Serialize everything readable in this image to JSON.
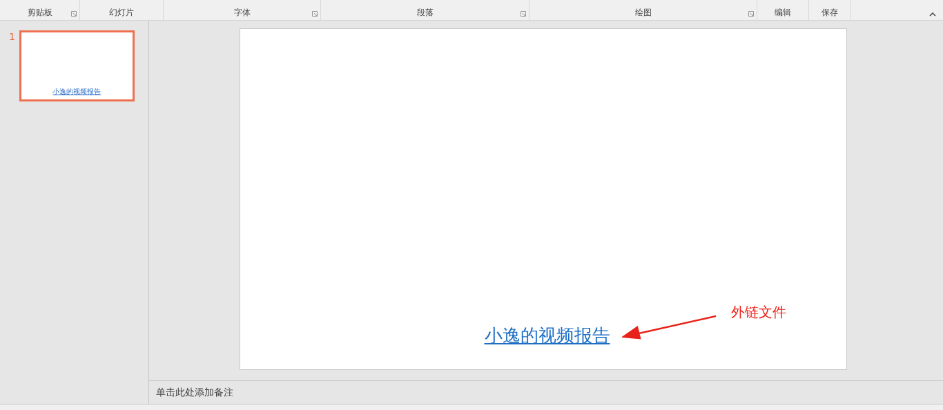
{
  "ribbon": {
    "groups": [
      {
        "label": "剪贴板",
        "launcher": true
      },
      {
        "label": "幻灯片",
        "launcher": false
      },
      {
        "label": "字体",
        "launcher": true
      },
      {
        "label": "段落",
        "launcher": true
      },
      {
        "label": "绘图",
        "launcher": true
      },
      {
        "label": "编辑",
        "launcher": false
      },
      {
        "label": "保存",
        "launcher": false
      }
    ]
  },
  "thumbnails": [
    {
      "number": "1",
      "selected": true,
      "link_text": "小逸的视频报告"
    }
  ],
  "slide": {
    "link_text": "小逸的视频报告"
  },
  "annotation": {
    "text": "外链文件"
  },
  "notes": {
    "placeholder": "单击此处添加备注"
  }
}
